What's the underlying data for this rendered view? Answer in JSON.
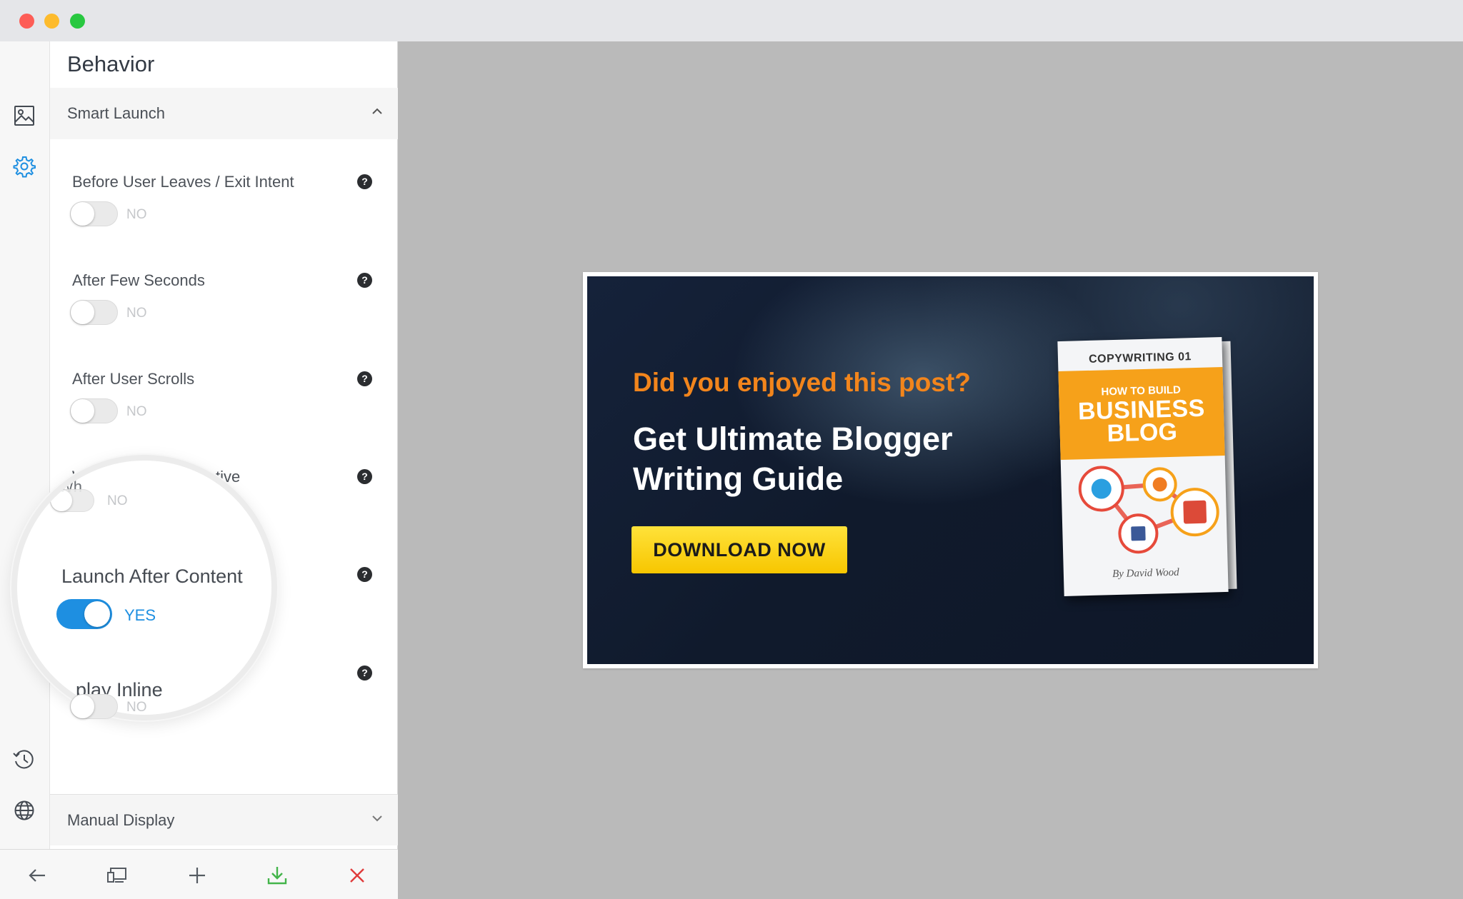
{
  "colors": {
    "accent_blue": "#1e8fe1",
    "canvas_gray": "#bababa",
    "banner_orange": "#f2851c",
    "button_yellow": "#f7c600",
    "download_green": "#43b44a",
    "close_red": "#e03b3b"
  },
  "panel": {
    "title": "Behavior"
  },
  "smart_launch": {
    "header": "Smart Launch",
    "options": [
      {
        "label": "Before User Leaves / Exit Intent",
        "state": "NO"
      },
      {
        "label": "After Few Seconds",
        "state": "NO"
      },
      {
        "label": "After User Scrolls",
        "state": "NO"
      },
      {
        "label_partial": "Wh",
        "label_end": "ctive",
        "state": "NO"
      },
      {
        "label": "Launch After Content",
        "state": "YES"
      },
      {
        "label_partial": "play Inline",
        "state": "NO"
      }
    ]
  },
  "manual_display": {
    "header": "Manual Display"
  },
  "rail_icons": [
    "image-icon",
    "gear-icon",
    "history-icon",
    "globe-icon"
  ],
  "toolbar_icons": [
    "back-arrow-icon",
    "devices-icon",
    "plus-icon",
    "download-icon",
    "close-icon"
  ],
  "banner": {
    "question": "Did you enjoyed this post?",
    "headline_line1": "Get Ultimate Blogger",
    "headline_line2": "Writing Guide",
    "button_label": "DOWNLOAD NOW",
    "book": {
      "series": "COPYWRITING 01",
      "small_title": "HOW TO BUILD",
      "big_title_1": "BUSINESS",
      "big_title_2": "BLOG",
      "author": "By David Wood"
    }
  }
}
